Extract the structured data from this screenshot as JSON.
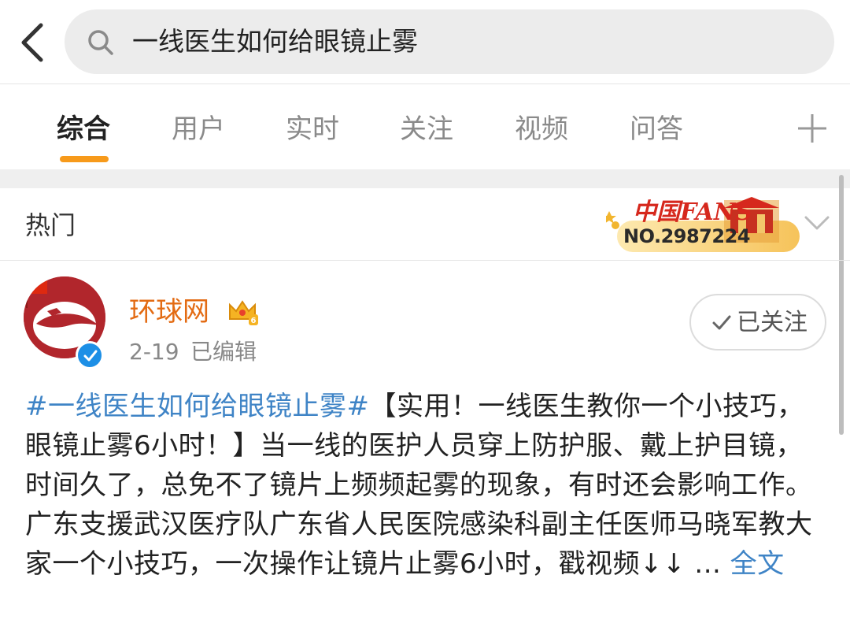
{
  "search": {
    "query": "一线医生如何给眼镜止雾"
  },
  "tabs": [
    {
      "label": "综合",
      "active": true
    },
    {
      "label": "用户"
    },
    {
      "label": "实时"
    },
    {
      "label": "关注"
    },
    {
      "label": "视频"
    },
    {
      "label": "问答"
    }
  ],
  "hot": {
    "label": "热门"
  },
  "fans_badge": {
    "title": "中国FANS",
    "number": "NO.2987224"
  },
  "post": {
    "author": "环球网",
    "date": "2-19",
    "edited": "已编辑",
    "follow_label": "已关注",
    "topic": "#一线医生如何给眼镜止雾#",
    "body": "【实用！一线医生教你一个小技巧，眼镜止雾6小时！】当一线的医护人员穿上防护服、戴上护目镜，时间久了，总免不了镜片上频频起雾的现象，有时还会影响工作。广东支援武汉医疗队广东省人民医院感染科副主任医师马晓军教大家一个小技巧，一次操作让镜片止雾6小时，戳视频↓↓ ...",
    "more_label": "全文"
  },
  "colors": {
    "accent": "#f79a1b",
    "link": "#3f84c6",
    "author": "#e36b13",
    "verified": "#1d8fe6"
  }
}
